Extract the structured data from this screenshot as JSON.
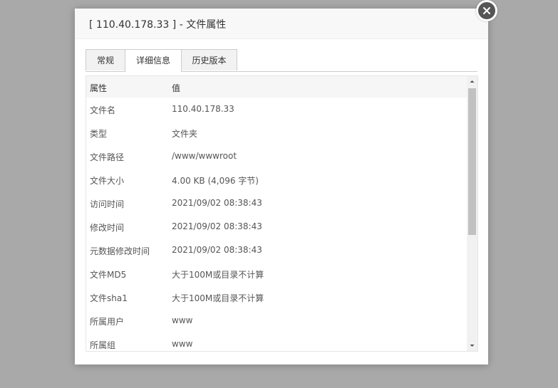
{
  "dialog": {
    "title": "[ 110.40.178.33 ] - 文件属性"
  },
  "tabs": [
    {
      "label": "常规",
      "active": false
    },
    {
      "label": "详细信息",
      "active": true
    },
    {
      "label": "历史版本",
      "active": false
    }
  ],
  "table": {
    "headers": {
      "attr": "属性",
      "value": "值"
    },
    "rows": [
      {
        "attr": "文件名",
        "value": "110.40.178.33"
      },
      {
        "attr": "类型",
        "value": "文件夹"
      },
      {
        "attr": "文件路径",
        "value": "/www/wwwroot"
      },
      {
        "attr": "文件大小",
        "value": "4.00 KB (4,096 字节)"
      },
      {
        "attr": "访问时间",
        "value": "2021/09/02 08:38:43"
      },
      {
        "attr": "修改时间",
        "value": "2021/09/02 08:38:43"
      },
      {
        "attr": "元数据修改时间",
        "value": "2021/09/02 08:38:43"
      },
      {
        "attr": "文件MD5",
        "value": "大于100M或目录不计算"
      },
      {
        "attr": "文件sha1",
        "value": "大于100M或目录不计算"
      },
      {
        "attr": "所属用户",
        "value": "www"
      },
      {
        "attr": "所属组",
        "value": "www"
      }
    ]
  },
  "icons": {
    "close": "close-icon",
    "scroll_up": "scroll-up-arrow-icon",
    "scroll_down": "scroll-down-arrow-icon"
  }
}
